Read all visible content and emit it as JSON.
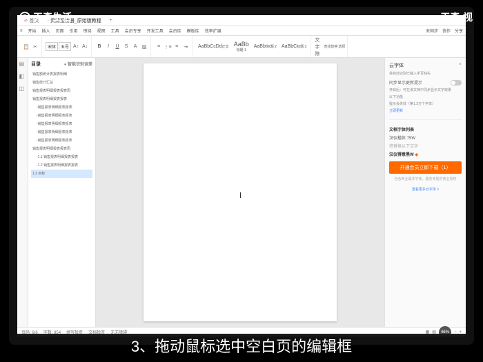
{
  "watermark": {
    "left": "天奇生活",
    "right": "天奇·视"
  },
  "tabs": {
    "t1": "首页",
    "t2": "资源搜索器_原始版教程"
  },
  "menu": {
    "m1": "开始",
    "m2": "插入",
    "m3": "页面",
    "m4": "引用",
    "m5": "审阅",
    "m6": "视图",
    "m7": "工具",
    "m8": "会员专享",
    "m9": "开发工具",
    "m10": "会员库",
    "m11": "模板库",
    "m12": "效率扩展",
    "r1": "未同步",
    "r2": "协作",
    "r3": "分享"
  },
  "toolbar": {
    "font": "宋体",
    "size": "五号",
    "b": "B",
    "i": "I",
    "u": "U",
    "s": "S",
    "style1": "AaBbCcDd",
    "style2": "AaBb",
    "style3": "AaBbt",
    "style4": "AaBbC",
    "label1": "正文",
    "label2": "标题 1",
    "label3": "标题 2",
    "label4": "标题 3",
    "find": "查找替换",
    "select": "选择"
  },
  "outline": {
    "title": "目录",
    "sub": "● 智能识别误差",
    "items": [
      "销售额统计表报表明细",
      "销售统计汇总",
      "销售报表明细报表报表周",
      "销售报表明细报表报表",
      "-销售报表明细报表报表",
      "-销售报表明细报表报表",
      "-销售报表明细报表报表",
      "-销售报表明细报表报表",
      "-销售报表明细报表报表",
      "销售报表明细报表报表周",
      "-1.1 销售报表明细报表报表",
      "-1.2 销售报表明细报表报表",
      "1.3 目标"
    ]
  },
  "rightPanel": {
    "title": "云字体",
    "hint": "将自动识别已输入手写缺失",
    "row1": "同步显示更新提示",
    "desc1": "开启后：可在该文档中同步显示文字效果",
    "desc2": "以下功能",
    "desc3": "提示会失效（第1.3万个字体）",
    "desc4": "立即更新",
    "section": "文档字体列表",
    "item1": "汉仪楷体 75W",
    "item2": "将替换以下文字",
    "item3": "汉仪得意黑W",
    "btn": "开通会员立即下载（1）",
    "footer1": "包含商业版本字体，服务商提供商业授权",
    "footer2": "查看更多云字体 >"
  },
  "status": {
    "page": "页码: 6/6",
    "words": "字数: 854",
    "mode1": "拼写检查",
    "mode2": "文档检查",
    "mode3": "无无障碍",
    "zoom": "46%"
  },
  "caption": "3、拖动鼠标选中空白页的编辑框"
}
